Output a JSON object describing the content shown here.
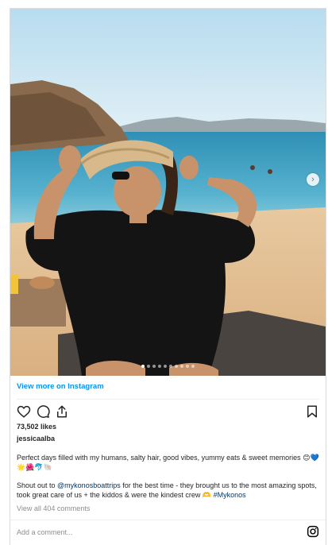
{
  "post": {
    "view_more": "View more on Instagram",
    "likes": "73,502 likes",
    "username": "jessicaalba",
    "caption_1": "Perfect days filled with my humans, salty hair, good vibes, yummy eats & sweet memories 😊💙🌟🌺🐬🐚",
    "caption_2_a": "Shout out to ",
    "caption_2_mention": "@mykonosboattrips",
    "caption_2_b": " for the best time - they brought us to the most amazing spots, took great care of us + the kiddos & were the kindest crew 🫶 ",
    "caption_2_hashtag": "#Mykonos",
    "view_all_comments": "View all 404 comments",
    "add_comment_placeholder": "Add a comment...",
    "carousel": {
      "slide_count": 10,
      "active_index": 0
    }
  },
  "icons": {
    "like": "heart-icon",
    "comment": "comment-icon",
    "share": "share-icon",
    "save": "bookmark-icon",
    "logo": "instagram-logo-icon",
    "next": "chevron-right-icon"
  },
  "colors": {
    "link_blue": "#0095f6",
    "mention_blue": "#00376b",
    "muted_text": "#8e8e8e",
    "border": "#dbdbdb"
  }
}
